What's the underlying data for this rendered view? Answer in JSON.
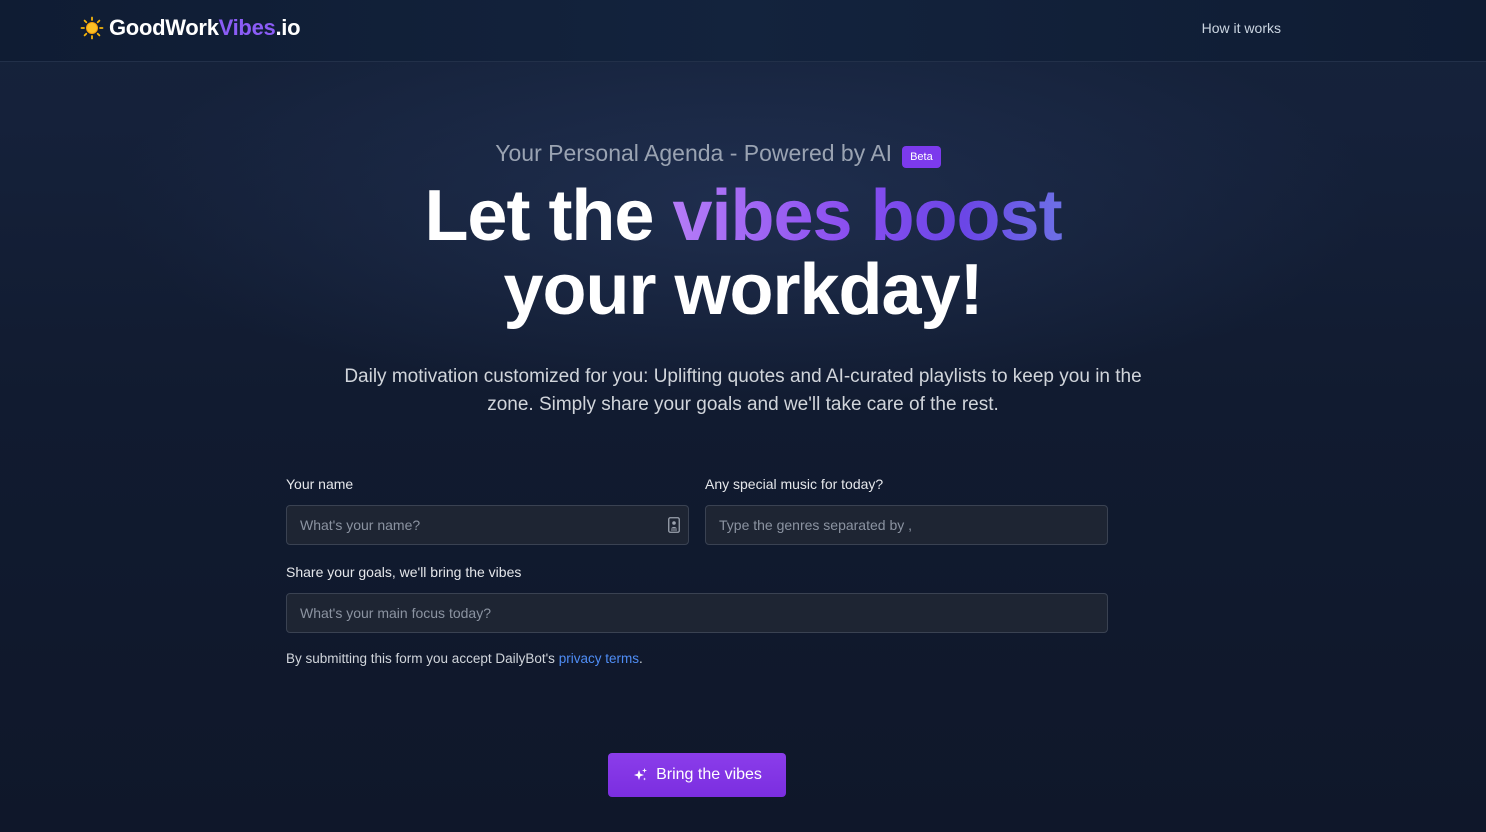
{
  "header": {
    "logo_part1": "GoodWork",
    "logo_part2": "Vibes",
    "logo_part3": ".io",
    "nav_how_it_works": "How it works"
  },
  "hero": {
    "tagline": "Your Personal Agenda - Powered by AI",
    "beta_badge": "Beta",
    "headline_plain1": "Let the ",
    "headline_accent": "vibes boost",
    "headline_line2": "your workday!",
    "subtitle": "Daily motivation customized for you: Uplifting quotes and AI-curated playlists to keep you in the zone. Simply share your goals and we'll take care of the rest."
  },
  "form": {
    "name_label": "Your name",
    "name_placeholder": "What's your name?",
    "name_value": "",
    "music_label": "Any special music for today?",
    "music_placeholder": "Type the genres separated by ,",
    "music_value": "",
    "goals_label": "Share your goals, we'll bring the vibes",
    "goals_placeholder": "What's your main focus today?",
    "goals_value": "",
    "consent_prefix": "By submitting this form you accept DailyBot's ",
    "consent_link": "privacy terms",
    "consent_suffix": ".",
    "submit_label": "Bring the vibes"
  },
  "icons": {
    "logo": "sun-icon",
    "name_field": "contact-card-icon",
    "submit": "sparkles-icon"
  },
  "colors": {
    "accent": "#8b5cf6",
    "button": "#7e22ce",
    "link": "#4f8df5",
    "background": "#0f172a"
  }
}
